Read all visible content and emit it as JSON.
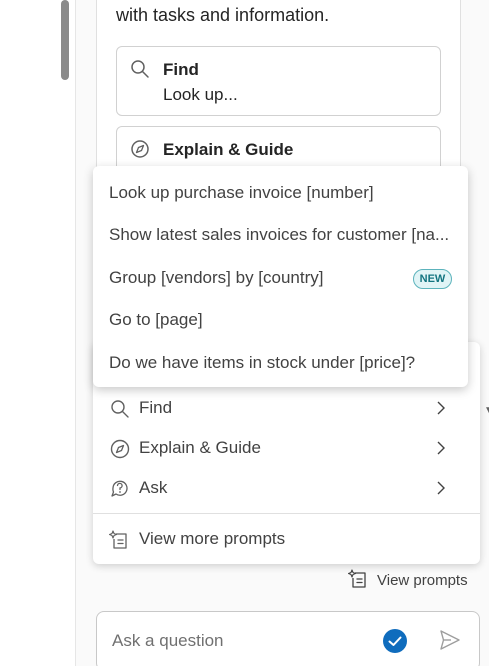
{
  "card": {
    "intro": "with tasks and information.",
    "tiles": [
      {
        "title": "Find",
        "subtitle": "Look up...",
        "icon": "search-icon"
      },
      {
        "title": "Explain & Guide",
        "subtitle": "",
        "icon": "compass-icon"
      }
    ]
  },
  "submenu": {
    "items": [
      {
        "label": "Look up purchase invoice [number]"
      },
      {
        "label": "Show latest sales invoices for customer [na..."
      },
      {
        "label": "Group [vendors] by [country]",
        "badge": "NEW"
      },
      {
        "label": "Go to [page]"
      },
      {
        "label": "Do we have items in stock under [price]?"
      }
    ]
  },
  "menu": {
    "items": [
      {
        "label": "Find",
        "icon": "search-icon"
      },
      {
        "label": "Explain & Guide",
        "icon": "compass-icon"
      },
      {
        "label": "Ask",
        "icon": "chat-question-icon"
      }
    ],
    "more": {
      "label": "View more prompts",
      "icon": "sparkle-document-icon"
    }
  },
  "view_prompts": {
    "label": "View prompts",
    "icon": "sparkle-document-icon"
  },
  "ask": {
    "placeholder": "Ask a question"
  },
  "colors": {
    "accent": "#0f6cbd",
    "badge_border": "#5cb3bc",
    "badge_text": "#127480"
  }
}
